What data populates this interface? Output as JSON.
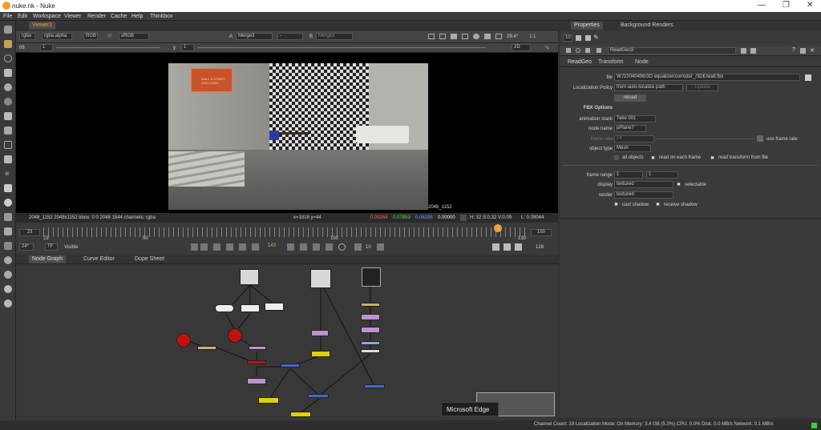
{
  "window": {
    "title": "nuke.nk - Nuke"
  },
  "menu": [
    "File",
    "Edit",
    "Workspace",
    "Viewer",
    "Render",
    "Cache",
    "Help",
    "Thinkbox"
  ],
  "viewer": {
    "tab": "Viewer1",
    "channels": "rgba",
    "alpha": "rgba.alpha",
    "colorspace_mode": "RGB",
    "ip": "IP",
    "lut": "sRGB",
    "a_input": "Merge3",
    "a_op": "-",
    "b_input": "Merge3",
    "gain_label": "f/8",
    "gain_value": "1",
    "gamma_label": "y",
    "gamma_value": "1",
    "fps": "29.4*",
    "zoom": "1:1",
    "view_mode": "2D",
    "image_label": "2048_1152",
    "wall_sign_text": "WALL & STAIRS ENCLOSED",
    "info": {
      "format": "2048_1152 2048x1152  bbox: 0 0 2048 1544 channels: rgba",
      "coords": "x=1818 y=44",
      "r": "0.09264",
      "g": "0.07859",
      "b": "0.06298",
      "a": "0.00000",
      "hsv": "H: 32 S:0.32 V:0.09",
      "lum": "L: 0.08044"
    }
  },
  "timeline": {
    "start": "23",
    "end": "150",
    "in": "23",
    "mid": "50",
    "mark100": "100",
    "out": "150",
    "mark130": "130",
    "fps": "24*",
    "tf": "TF",
    "visible": "Visible",
    "current_frame": "143",
    "step": "10",
    "end_frame": "128"
  },
  "nodegraph": {
    "tabs": [
      "Node Graph",
      "Curve Editor",
      "Dope Sheet"
    ],
    "tooltip": "Microsoft Edge"
  },
  "properties": {
    "tabs": [
      "Properties",
      "Background Renders"
    ],
    "count": "10",
    "node_name": "ReadGeo3",
    "subtabs": [
      "ReadGeo",
      "Transform",
      "Node"
    ],
    "file_label": "file",
    "file_value": "W:/22040496/3D equalizer/corrodor_/3DE/wall.fbx",
    "localization_label": "Localization Policy",
    "localization_value": "from auto-localize path",
    "update_btn": "Update",
    "reload_btn": "reload",
    "fbx_header": "FBX Options",
    "anim_stack_label": "animation stack",
    "anim_stack_value": "Take 001",
    "node_name_label": "node name",
    "node_name_value": "pPlane7",
    "frame_rate_label": "frame rate",
    "frame_rate_value": "24",
    "use_frame_rate": "use frame rate",
    "object_type_label": "object type",
    "object_type_value": "Mesh",
    "all_objects": "all objects",
    "read_each_frame": "read on each frame",
    "read_transform": "read transform from file",
    "frame_range_label": "frame range",
    "frame_range_a": "1",
    "frame_range_b": "1",
    "display_label": "display",
    "display_value": "textured",
    "selectable": "selectable",
    "render_label": "render",
    "render_value": "textured",
    "cast_shadow": "cast shadow",
    "receive_shadow": "receive shadow"
  },
  "status": {
    "text": "Channel Count: 19  Localization Mode: On  Memory: 3.4 GB (5.3%)  CPU: 0.0%  Disk: 0.0 MB/s  Network: 0.1 MB/s"
  },
  "colors": {
    "accent": "#f0a040",
    "read_red": "#c01010",
    "merge_blue": "#4466cc",
    "grade_purple": "#b080c0",
    "yellow": "#c8b800"
  }
}
